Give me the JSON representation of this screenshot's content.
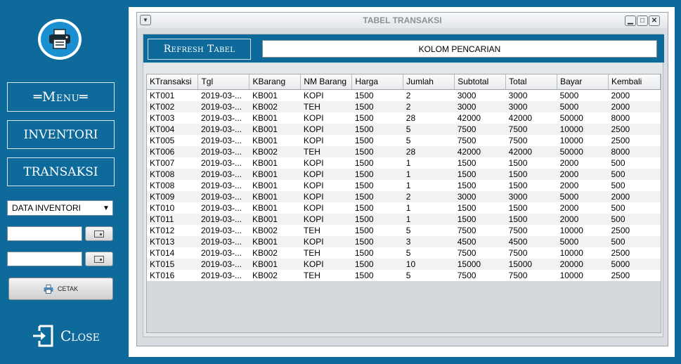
{
  "sidebar": {
    "menu_label": "═Menu═",
    "inventori_label": "INVENTORI",
    "transaksi_label": "TRANSAKSI",
    "select_value": "DATA INVENTORI",
    "date1_value": "",
    "date2_value": "",
    "cetak_label": "CETAK",
    "close_label": "Close"
  },
  "window": {
    "title": "TABEL TRANSAKSI",
    "refresh_label": "Refresh Tabel",
    "search_value": "KOLOM PENCARIAN"
  },
  "table": {
    "columns": [
      "KTransaksi",
      "Tgl",
      "KBarang",
      "NM Barang",
      "Harga",
      "Jumlah",
      "Subtotal",
      "Total",
      "Bayar",
      "Kembali"
    ],
    "rows": [
      [
        "KT001",
        "2019-03-...",
        "KB001",
        "KOPI",
        "1500",
        "2",
        "3000",
        "3000",
        "5000",
        "2000"
      ],
      [
        "KT002",
        "2019-03-...",
        "KB002",
        "TEH",
        "1500",
        "2",
        "3000",
        "3000",
        "5000",
        "2000"
      ],
      [
        "KT003",
        "2019-03-...",
        "KB001",
        "KOPI",
        "1500",
        "28",
        "42000",
        "42000",
        "50000",
        "8000"
      ],
      [
        "KT004",
        "2019-03-...",
        "KB001",
        "KOPI",
        "1500",
        "5",
        "7500",
        "7500",
        "10000",
        "2500"
      ],
      [
        "KT005",
        "2019-03-...",
        "KB001",
        "KOPI",
        "1500",
        "5",
        "7500",
        "7500",
        "10000",
        "2500"
      ],
      [
        "KT006",
        "2019-03-...",
        "KB002",
        "TEH",
        "1500",
        "28",
        "42000",
        "42000",
        "50000",
        "8000"
      ],
      [
        "KT007",
        "2019-03-...",
        "KB001",
        "KOPI",
        "1500",
        "1",
        "1500",
        "1500",
        "2000",
        "500"
      ],
      [
        "KT008",
        "2019-03-...",
        "KB001",
        "KOPI",
        "1500",
        "1",
        "1500",
        "1500",
        "2000",
        "500"
      ],
      [
        "KT008",
        "2019-03-...",
        "KB001",
        "KOPI",
        "1500",
        "1",
        "1500",
        "1500",
        "2000",
        "500"
      ],
      [
        "KT009",
        "2019-03-...",
        "KB001",
        "KOPI",
        "1500",
        "2",
        "3000",
        "3000",
        "5000",
        "2000"
      ],
      [
        "KT010",
        "2019-03-...",
        "KB001",
        "KOPI",
        "1500",
        "1",
        "1500",
        "1500",
        "2000",
        "500"
      ],
      [
        "KT011",
        "2019-03-...",
        "KB001",
        "KOPI",
        "1500",
        "1",
        "1500",
        "1500",
        "2000",
        "500"
      ],
      [
        "KT012",
        "2019-03-...",
        "KB002",
        "TEH",
        "1500",
        "5",
        "7500",
        "7500",
        "10000",
        "2500"
      ],
      [
        "KT013",
        "2019-03-...",
        "KB001",
        "KOPI",
        "1500",
        "3",
        "4500",
        "4500",
        "5000",
        "500"
      ],
      [
        "KT014",
        "2019-03-...",
        "KB002",
        "TEH",
        "1500",
        "5",
        "7500",
        "7500",
        "10000",
        "2500"
      ],
      [
        "KT015",
        "2019-03-...",
        "KB001",
        "KOPI",
        "1500",
        "10",
        "15000",
        "15000",
        "20000",
        "5000"
      ],
      [
        "KT016",
        "2019-03-...",
        "KB002",
        "TEH",
        "1500",
        "5",
        "7500",
        "7500",
        "10000",
        "2500"
      ]
    ]
  },
  "icons": {
    "logo": "printer-icon",
    "calendar": "calendar-icon",
    "cetak": "printer-icon",
    "close": "exit-icon"
  },
  "colors": {
    "background": "#0e6a9a",
    "logo_blue": "#1a8fd1"
  }
}
